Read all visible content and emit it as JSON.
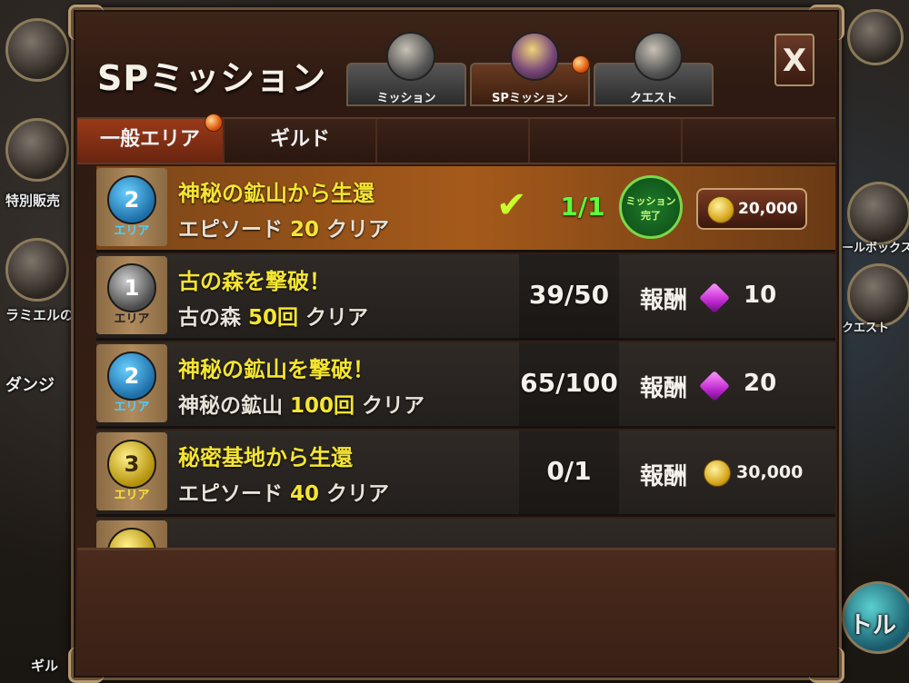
{
  "window": {
    "title": "SPミッション",
    "close_label": "X"
  },
  "tabs": [
    {
      "label": "ミッション",
      "active": false
    },
    {
      "label": "SPミッション",
      "active": true
    },
    {
      "label": "クエスト",
      "active": false
    }
  ],
  "subtabs": [
    {
      "label": "一般エリア",
      "active": true
    },
    {
      "label": "ギルド",
      "active": false
    }
  ],
  "missions": [
    {
      "area": "2",
      "area_label": "エリア",
      "badge_color": "blue",
      "title": "神秘の鉱山から生還",
      "desc_prefix": "エピソード",
      "desc_num": "20",
      "desc_suffix": "クリア",
      "progress": "1/1",
      "completed": true,
      "complete_seal": "ミッション完了",
      "reward_type": "coin",
      "reward_value": "20,000"
    },
    {
      "area": "1",
      "area_label": "エリア",
      "badge_color": "gray",
      "title": "古の森を撃破！",
      "desc_prefix": "古の森",
      "desc_num": "50回",
      "desc_suffix": "クリア",
      "progress": "39/50",
      "completed": false,
      "reward_label": "報酬",
      "reward_type": "gem",
      "reward_value": "10"
    },
    {
      "area": "2",
      "area_label": "エリア",
      "badge_color": "blue",
      "title": "神秘の鉱山を撃破！",
      "desc_prefix": "神秘の鉱山",
      "desc_num": "100回",
      "desc_suffix": "クリア",
      "progress": "65/100",
      "completed": false,
      "reward_label": "報酬",
      "reward_type": "gem",
      "reward_value": "20"
    },
    {
      "area": "3",
      "area_label": "エリア",
      "badge_color": "gold",
      "title": "秘密基地から生還",
      "desc_prefix": "エピソード",
      "desc_num": "40",
      "desc_suffix": "クリア",
      "progress": "0/1",
      "completed": false,
      "reward_label": "報酬",
      "reward_type": "coin",
      "reward_value": "30,000"
    }
  ],
  "background_labels": {
    "left_shop": "特別販売",
    "left_event": "ラミエルの",
    "left_dungeon": "ダンジ",
    "left_bottom": "ギル",
    "right_mailbox": "ールボックス",
    "right_quest": "クエスト",
    "right_battle": "トル"
  },
  "colors": {
    "title_yellow": "#f5e532",
    "completed_row": "#a55a1a",
    "progress_done": "#5aff3a"
  }
}
